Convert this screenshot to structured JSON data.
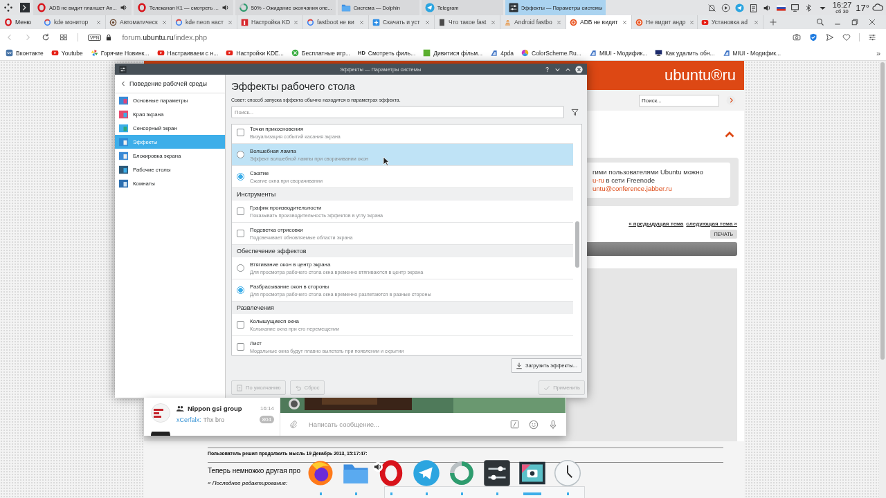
{
  "panel": {
    "tasks": [
      {
        "title": "ADB не видит планшет An...",
        "kind": "opera",
        "audio": true,
        "selected": false
      },
      {
        "title": "Телеканал K1 — смотреть ...",
        "kind": "opera",
        "audio": true,
        "selected": false
      },
      {
        "title": "50% - Ожидание окончания опе...",
        "kind": "progress",
        "audio": false,
        "selected": false
      },
      {
        "title": "Система — Dolphin",
        "kind": "folder",
        "audio": false,
        "selected": false
      },
      {
        "title": "Telegram",
        "kind": "telegram",
        "audio": false,
        "selected": false
      },
      {
        "title": "Эффекты — Параметры системы",
        "kind": "settings",
        "audio": false,
        "selected": true
      }
    ],
    "clock": {
      "time": "16:27",
      "date": "сб 30"
    },
    "weather": "17°"
  },
  "browser": {
    "menu": "Меню",
    "tabs": [
      {
        "title": "kde монитор",
        "kind": "google",
        "selected": false
      },
      {
        "title": "Автоматическ",
        "kind": "spiral",
        "selected": false
      },
      {
        "title": "kde neon наст",
        "kind": "google",
        "selected": false
      },
      {
        "title": "Настройка KD",
        "kind": "redsq",
        "selected": false
      },
      {
        "title": "fastboot не ви",
        "kind": "google",
        "selected": false
      },
      {
        "title": "Скачать и уст",
        "kind": "bluesq",
        "selected": false
      },
      {
        "title": "Что такое fast",
        "kind": "doc",
        "selected": false
      },
      {
        "title": "Android fastbo",
        "kind": "stack",
        "selected": false
      },
      {
        "title": "ADB не видит",
        "kind": "ubuntu",
        "selected": true
      },
      {
        "title": "Не видит андр",
        "kind": "ubuntu",
        "selected": false
      },
      {
        "title": "Установка ad",
        "kind": "youtube",
        "selected": false
      }
    ],
    "vpn": "VPN",
    "url": {
      "prefix": "forum.",
      "domain": "ubuntu.ru",
      "suffix": "/index.php"
    },
    "bookmarks": [
      {
        "label": "Вконтакте",
        "kind": "vk"
      },
      {
        "label": "Youtube",
        "kind": "youtube"
      },
      {
        "label": "Горячие Новинк...",
        "kind": "pinwheel"
      },
      {
        "label": "Настраиваем с н...",
        "kind": "youtube"
      },
      {
        "label": "Настройки KDE...",
        "kind": "youtube"
      },
      {
        "label": "Бесплатные игр...",
        "kind": "greencircle"
      },
      {
        "label": "Смотреть филь...",
        "kind": "badge",
        "badge": "HD"
      },
      {
        "label": "Дивитися фільм...",
        "kind": "greensq"
      },
      {
        "label": "4pda",
        "kind": "miui"
      },
      {
        "label": "ColorScheme.Ru...",
        "kind": "colorwheel"
      },
      {
        "label": "MIUI - Модифик...",
        "kind": "miui"
      },
      {
        "label": "Как удалить обн...",
        "kind": "monitor"
      },
      {
        "label": "MIUI - Модифик...",
        "kind": "miui"
      }
    ],
    "more": "»"
  },
  "page": {
    "logo": "ubuntu®ru",
    "search": {
      "placeholder": "Поиск..."
    },
    "info": [
      [
        {
          "text": "гими пользователями Ubuntu можно",
          "link": false
        }
      ],
      [
        {
          "text": "u-ru",
          "link": true
        },
        {
          "text": " в сети Freenode",
          "link": false
        }
      ],
      [
        {
          "text": "untu@conference.jabber.ru",
          "link": true
        }
      ]
    ],
    "prev_link": "« предыдущая тема",
    "next_link": "следующая тема »",
    "print_button": "ПЕЧАТЬ",
    "post_meta": "Пользователь решил продолжить мысль 19 Декабрь 2013, 15:17:47:",
    "post_text": "Теперь немножко другая про",
    "edit_note": "« Последнее редактирование:"
  },
  "dialog": {
    "title": "Эффекты — Параметры системы",
    "back": "Поведение рабочей среды",
    "nav": [
      {
        "label": "Основные параметры",
        "kind": "general",
        "selected": false
      },
      {
        "label": "Края экрана",
        "kind": "edges",
        "selected": false
      },
      {
        "label": "Сенсорный экран",
        "kind": "touch",
        "selected": false
      },
      {
        "label": "Эффекты",
        "kind": "effects",
        "selected": true
      },
      {
        "label": "Блокировка экрана",
        "kind": "lock",
        "selected": false
      },
      {
        "label": "Рабочие столы",
        "kind": "desktops",
        "selected": false
      },
      {
        "label": "Комнаты",
        "kind": "rooms",
        "selected": false
      }
    ],
    "heading": "Эффекты рабочего стола",
    "tip": "Совет: способ запуска эффекта обычно находится в параметрах эффекта.",
    "search": {
      "placeholder": "Поиск..."
    },
    "list": [
      {
        "kind": "checkbox",
        "title": "Точки прикосновения",
        "desc": "Визуализация событий касания экрана",
        "checked": false,
        "highlighted": false
      },
      {
        "kind": "radio",
        "title": "Волшебная лампа",
        "desc": "Эффект волшебной лампы при сворачивании окон",
        "checked": false,
        "highlighted": true
      },
      {
        "kind": "radio",
        "title": "Сжатие",
        "desc": "Сжатие окна при сворачивании",
        "checked": true,
        "highlighted": false
      },
      {
        "kind": "group",
        "title": "Инструменты"
      },
      {
        "kind": "checkbox",
        "title": "График производительности",
        "desc": "Показывать производительность эффектов в углу экрана",
        "checked": false,
        "highlighted": false
      },
      {
        "kind": "checkbox",
        "title": "Подсветка отрисовки",
        "desc": "Подсвечивает обновляемые области экрана",
        "checked": false,
        "highlighted": false
      },
      {
        "kind": "group",
        "title": "Обеспечение эффектов"
      },
      {
        "kind": "radio",
        "title": "Втягивание окон в центр экрана",
        "desc": "Для просмотра рабочего стола окна временно втягиваются в центр экрана",
        "checked": false,
        "highlighted": false
      },
      {
        "kind": "radio",
        "title": "Разбрасывание окон в стороны",
        "desc": "Для просмотра рабочего стола окна временно разлетаются в разные стороны",
        "checked": true,
        "highlighted": false
      },
      {
        "kind": "group",
        "title": "Развлечения"
      },
      {
        "kind": "checkbox",
        "title": "Колышущиеся окна",
        "desc": "Колыхание окна при его перемещении",
        "checked": false,
        "highlighted": false
      },
      {
        "kind": "checkbox",
        "title": "Лист",
        "desc": "Модальные окна будут плавно вылетать при появлении и скрытии",
        "checked": false,
        "highlighted": false
      }
    ],
    "download_button": "Загрузить эффекты...",
    "footer": [
      {
        "label": "По умолчанию",
        "kind": "doc",
        "disabled": true
      },
      {
        "label": "Сброс",
        "kind": "undo",
        "disabled": true
      },
      {
        "label": "Применить",
        "kind": "check",
        "disabled": true
      }
    ]
  },
  "telegram": {
    "chat": {
      "name": "Nippon gsi group",
      "time": "16:14",
      "sender": "xCerfalx:",
      "text": "Thx bro",
      "unread": "804"
    },
    "composer": {
      "placeholder": "Написать сообщение..."
    }
  },
  "dock": {
    "items": [
      {
        "kind": "firefox",
        "active": false,
        "audio": false
      },
      {
        "kind": "folder",
        "active": false,
        "audio": false
      },
      {
        "kind": "opera",
        "active": false,
        "audio": true
      },
      {
        "kind": "telegram",
        "active": false,
        "audio": false
      },
      {
        "kind": "progress",
        "active": false,
        "audio": false
      },
      {
        "kind": "settings",
        "active": false,
        "audio": false
      },
      {
        "kind": "screenshot",
        "active": true,
        "audio": false
      },
      {
        "kind": "clock",
        "active": false,
        "audio": false
      }
    ]
  }
}
